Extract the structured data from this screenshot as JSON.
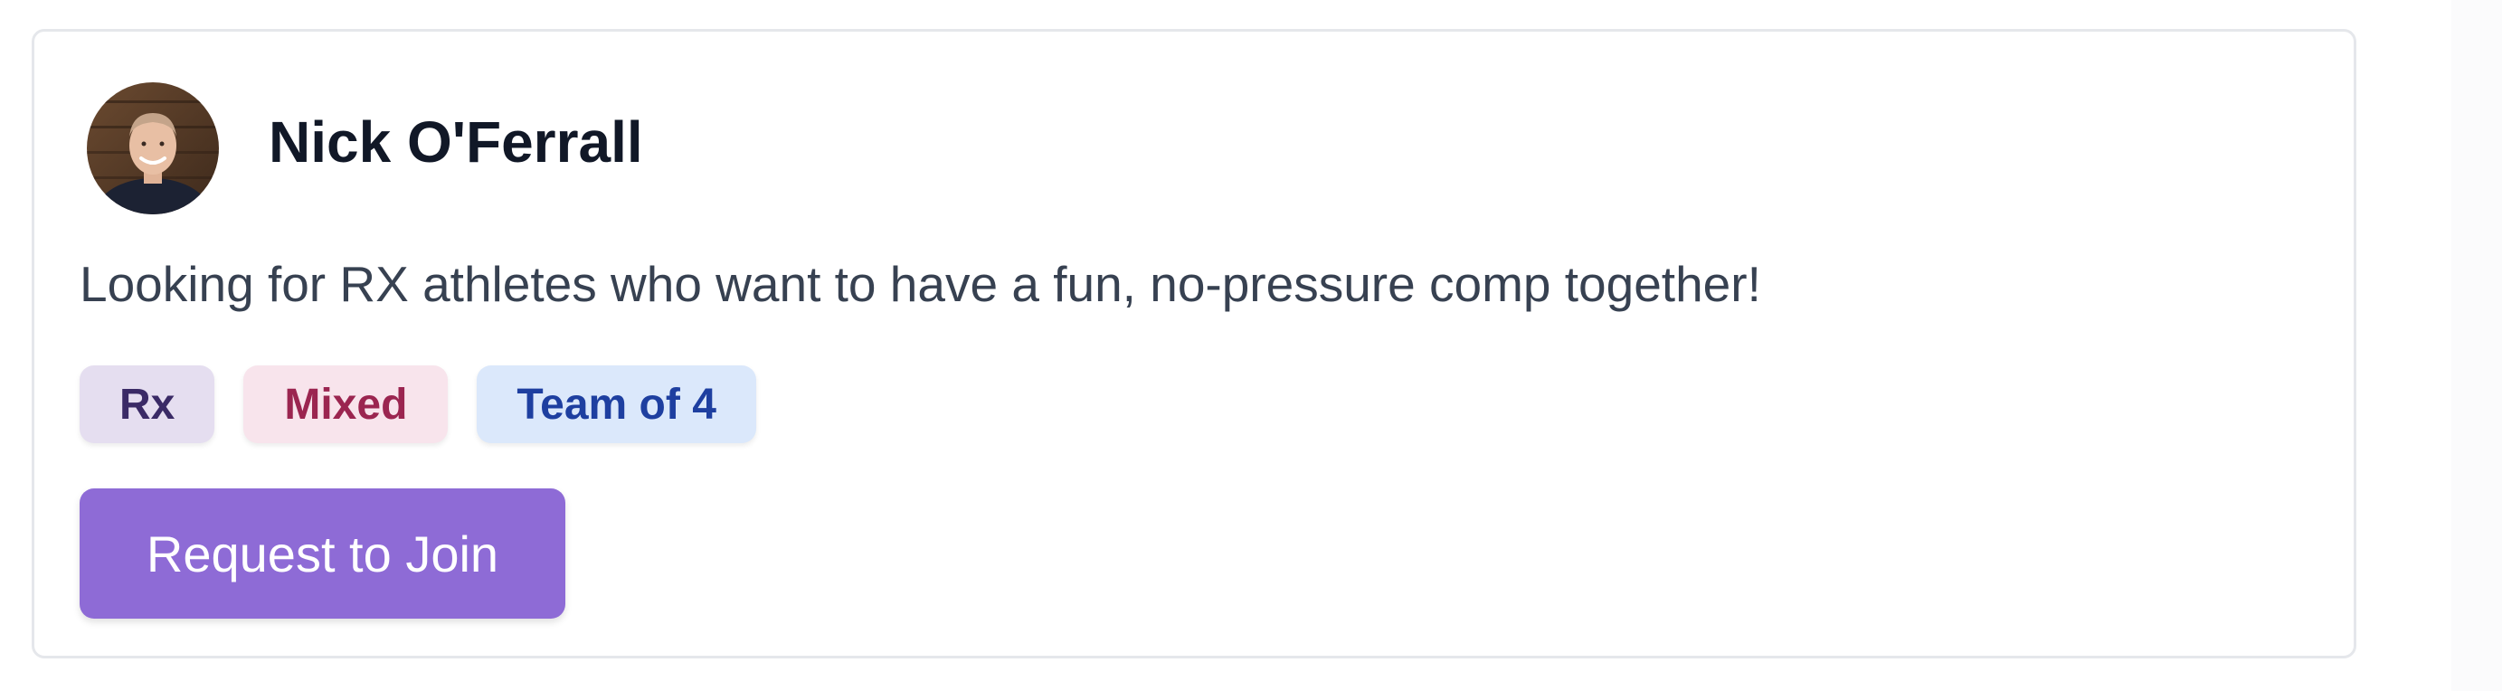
{
  "profile": {
    "name": "Nick O'Ferrall",
    "avatar": "avatar-photo"
  },
  "post": {
    "description": "Looking for RX athletes who want to have a fun, no-pressure comp together!"
  },
  "tags": [
    {
      "label": "Rx",
      "color": "#3a2a66",
      "background": "#e5def0"
    },
    {
      "label": "Mixed",
      "color": "#9b2550",
      "background": "#f8e4ec"
    },
    {
      "label": "Team of 4",
      "color": "#1e3fa0",
      "background": "#dbe8fb"
    }
  ],
  "actions": {
    "join_label": "Request to Join",
    "join_color": "#8e6bd6"
  }
}
